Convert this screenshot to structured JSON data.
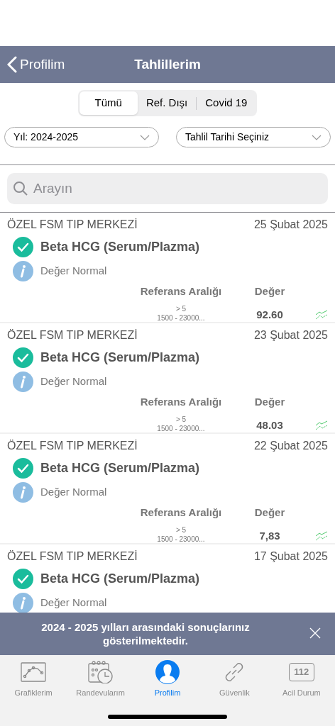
{
  "nav": {
    "back": "Profilim",
    "title": "Tahlillerim"
  },
  "segments": [
    {
      "label": "Tümü",
      "selected": true
    },
    {
      "label": "Ref. Dışı",
      "selected": false
    },
    {
      "label": "Covid 19",
      "selected": false
    }
  ],
  "filters": [
    {
      "value": "Yıl: 2024-2025"
    },
    {
      "value": "Tahlil Tarihi Seçiniz"
    }
  ],
  "search": {
    "placeholder": "Arayın"
  },
  "results": [
    {
      "lab": "ÖZEL FSM TIP MERKEZİ",
      "date": "25 Şubat 2025",
      "test": "Beta HCG (Serum/Plazma)",
      "status": "Değer Normal",
      "ref_label": "Referans Aralığı",
      "value_label": "Değer",
      "ref_lines": [
        "> 5",
        "1500 - 23000..."
      ],
      "value": "92.60"
    },
    {
      "lab": "ÖZEL FSM TIP MERKEZİ",
      "date": "23 Şubat 2025",
      "test": "Beta HCG (Serum/Plazma)",
      "status": "Değer Normal",
      "ref_label": "Referans Aralığı",
      "value_label": "Değer",
      "ref_lines": [
        "> 5",
        "1500 - 23000..."
      ],
      "value": "48.03"
    },
    {
      "lab": "ÖZEL FSM TIP MERKEZİ",
      "date": "22 Şubat 2025",
      "test": "Beta HCG (Serum/Plazma)",
      "status": "Değer Normal",
      "ref_label": "Referans Aralığı",
      "value_label": "Değer",
      "ref_lines": [
        "> 5",
        "1500 - 23000..."
      ],
      "value": "7,83"
    },
    {
      "lab": "ÖZEL FSM TIP MERKEZİ",
      "date": "17 Şubat 2025",
      "test": "Beta HCG (Serum/Plazma)",
      "status": "Değer Normal"
    }
  ],
  "banner": {
    "message": "2024 - 2025 yılları arasındaki sonuçlarınız gösterilmektedir."
  },
  "tabs": [
    {
      "kind": "chart",
      "label": "Grafiklerim",
      "selected": false
    },
    {
      "kind": "calendar",
      "label": "Randevularım",
      "selected": false
    },
    {
      "kind": "profile",
      "label": "Profilim",
      "selected": true
    },
    {
      "kind": "link",
      "label": "Güvenlik",
      "selected": false
    },
    {
      "kind": "emergency",
      "label": "Acil Durum",
      "selected": false,
      "badge": "112"
    }
  ]
}
